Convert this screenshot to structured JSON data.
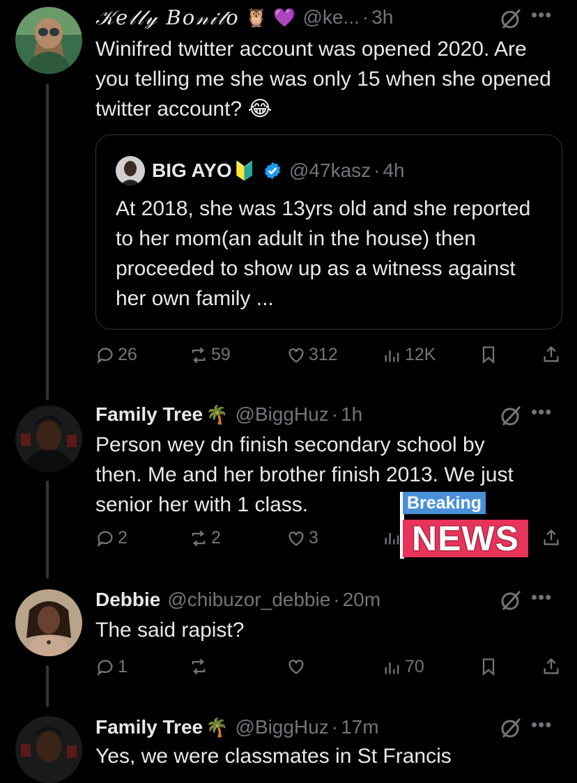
{
  "tweets": [
    {
      "name": "𝒦𝑒𝓁𝓁𝓎 𝐵𝑜𝓃𝒾𝓉𝑜",
      "emojis": [
        "🦉",
        "💜"
      ],
      "handle": "@ke...",
      "time": "3h",
      "text": "Winifred twitter account was opened 2020. Are you telling me she was only 15 when she opened twitter account? 😂",
      "quote": {
        "name": "BIG AYO",
        "emoji": "🔰",
        "handle": "@47kasz",
        "time": "4h",
        "text": "At 2018, she was 13yrs old and she reported to her mom(an adult in the house) then proceeded to show up as a witness against her own family ..."
      },
      "actions": {
        "replies": "26",
        "reposts": "59",
        "likes": "312",
        "views": "12K"
      }
    },
    {
      "name": "Family Tree",
      "emoji": "🌴",
      "handle": "@BiggHuz",
      "time": "1h",
      "text": "Person wey dn finish secondary school by then. Me and her brother finish 2013. We just senior her with 1 class.",
      "actions": {
        "replies": "2",
        "reposts": "2",
        "likes": "3"
      }
    },
    {
      "name": "Debbie",
      "handle": "@chibuzor_debbie",
      "time": "20m",
      "text": "The said rapist?",
      "actions": {
        "replies": "1",
        "views": "70"
      }
    },
    {
      "name": "Family Tree",
      "emoji": "🌴",
      "handle": "@BiggHuz",
      "time": "17m",
      "text": "Yes, we were classmates in St Francis"
    }
  ],
  "overlay": {
    "breaking": "Breaking",
    "news": "NEWS"
  },
  "colors": {
    "background": "#000000",
    "muted": "#71767b",
    "verified": "#1d9bf0",
    "news_red": "#e8335a",
    "breaking_blue": "#4a90d9"
  },
  "icons": [
    "reply-icon",
    "repost-icon",
    "like-icon",
    "views-icon",
    "bookmark-icon",
    "share-icon",
    "grok-icon",
    "more-icon",
    "verified-icon"
  ]
}
